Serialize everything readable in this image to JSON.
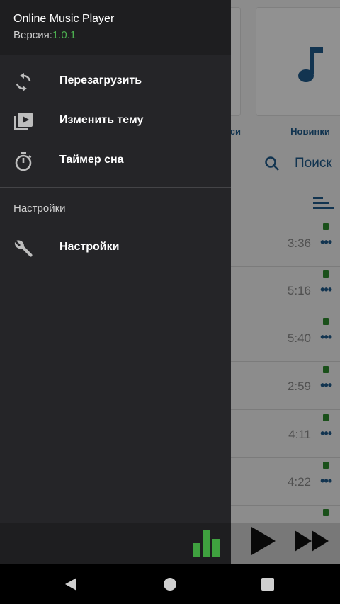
{
  "drawer": {
    "app_title": "Online Music Player",
    "version_label": "Версия:",
    "version_value": "1.0.1",
    "menu": [
      {
        "label": "Перезагрузить",
        "icon": "refresh-icon"
      },
      {
        "label": "Изменить тему",
        "icon": "theme-icon"
      },
      {
        "label": "Таймер сна",
        "icon": "timer-icon"
      }
    ],
    "section_title": "Настройки",
    "settings_item": {
      "label": "Настройки",
      "icon": "wrench-icon"
    },
    "footer_icon": "equalizer-icon"
  },
  "background": {
    "cards": [
      {
        "label": "...си"
      },
      {
        "label": "Новинки",
        "icon": "music-note-icon"
      }
    ],
    "search_label": "Поиск",
    "tracks": [
      {
        "duration": "3:36"
      },
      {
        "duration": "5:16"
      },
      {
        "duration": "5:40"
      },
      {
        "duration": "2:59"
      },
      {
        "duration": "4:11"
      },
      {
        "duration": "4:22"
      }
    ],
    "more_glyph": "•••"
  },
  "colors": {
    "accent": "#1f5a8a",
    "version_green": "#4caf50",
    "download_green": "#2d8a2d",
    "drawer_bg": "#252528"
  }
}
